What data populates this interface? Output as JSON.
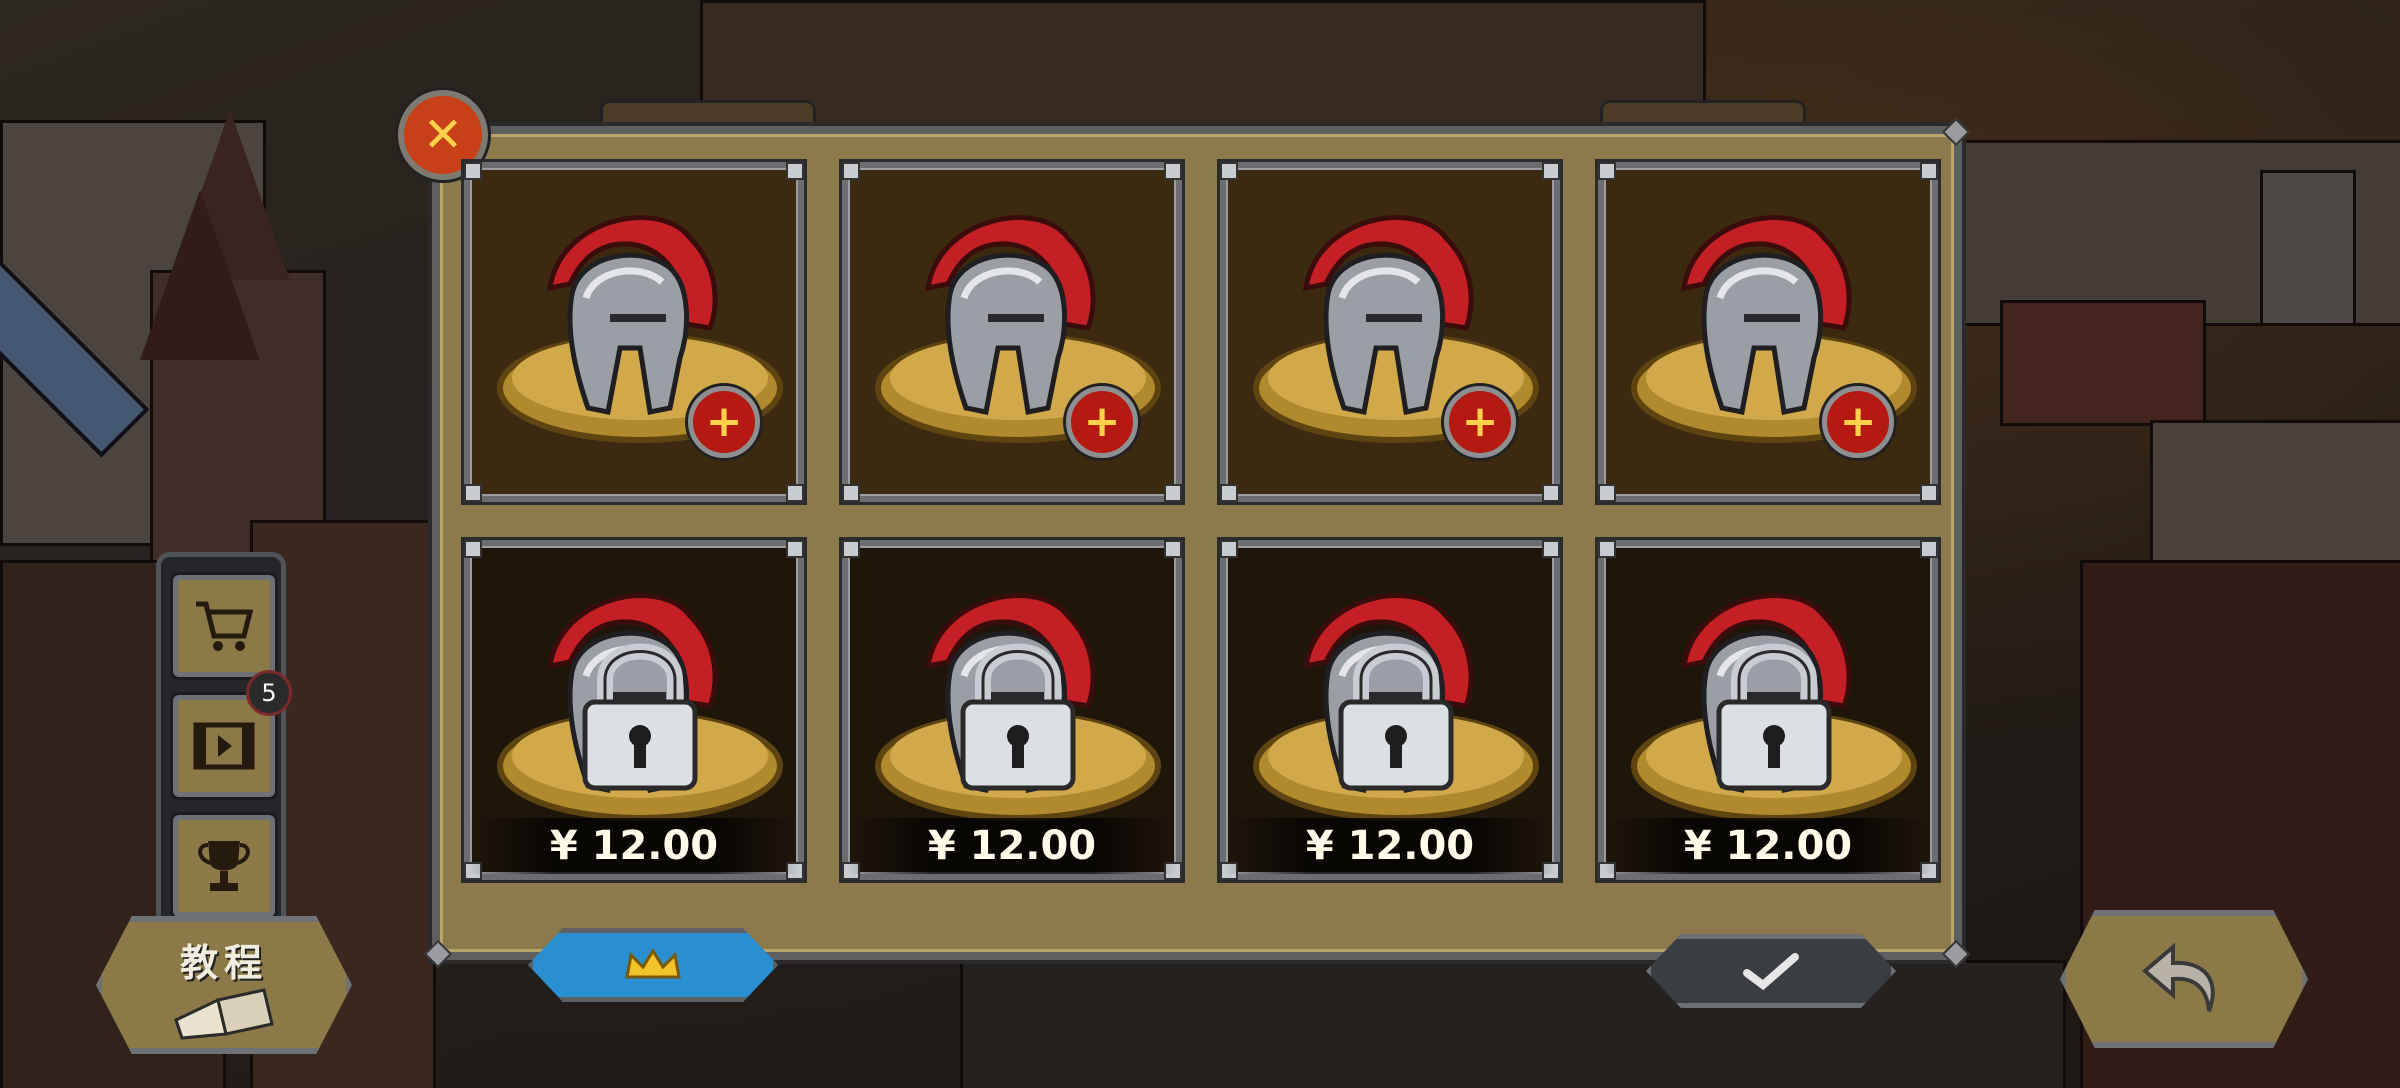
{
  "dialog": {
    "close_icon": "close-x-icon",
    "rows": [
      {
        "state": "unlocked",
        "slots": [
          {
            "item": "spartan-helmet",
            "action_icon": "plus-icon",
            "action_symbol": "+"
          },
          {
            "item": "spartan-helmet",
            "action_icon": "plus-icon",
            "action_symbol": "+"
          },
          {
            "item": "spartan-helmet",
            "action_icon": "plus-icon",
            "action_symbol": "+"
          },
          {
            "item": "spartan-helmet",
            "action_icon": "plus-icon",
            "action_symbol": "+"
          }
        ]
      },
      {
        "state": "locked",
        "slots": [
          {
            "item": "spartan-helmet",
            "lock_icon": "padlock-icon",
            "price": "¥ 12.00"
          },
          {
            "item": "spartan-helmet",
            "lock_icon": "padlock-icon",
            "price": "¥ 12.00"
          },
          {
            "item": "spartan-helmet",
            "lock_icon": "padlock-icon",
            "price": "¥ 12.00"
          },
          {
            "item": "spartan-helmet",
            "lock_icon": "padlock-icon",
            "price": "¥ 12.00"
          }
        ]
      }
    ],
    "crown_button_icon": "crown-icon",
    "confirm_button_icon": "checkmark-icon"
  },
  "sidebar": {
    "items": [
      {
        "icon": "shopping-cart-icon"
      },
      {
        "icon": "video-film-icon",
        "badge": "5"
      },
      {
        "icon": "trophy-icon"
      }
    ]
  },
  "tutorial_button": {
    "label": "教程",
    "icon": "book-icon"
  },
  "back_button": {
    "icon": "back-arrow-icon"
  },
  "colors": {
    "panel": "#8c7a4c",
    "slot_open": "#3c2a10",
    "slot_locked": "#1f160b",
    "plus_button": "#b51a12",
    "crown_button": "#2a8fd0",
    "confirm_button": "#3a3d42",
    "helmet_crest": "#c41f24"
  }
}
